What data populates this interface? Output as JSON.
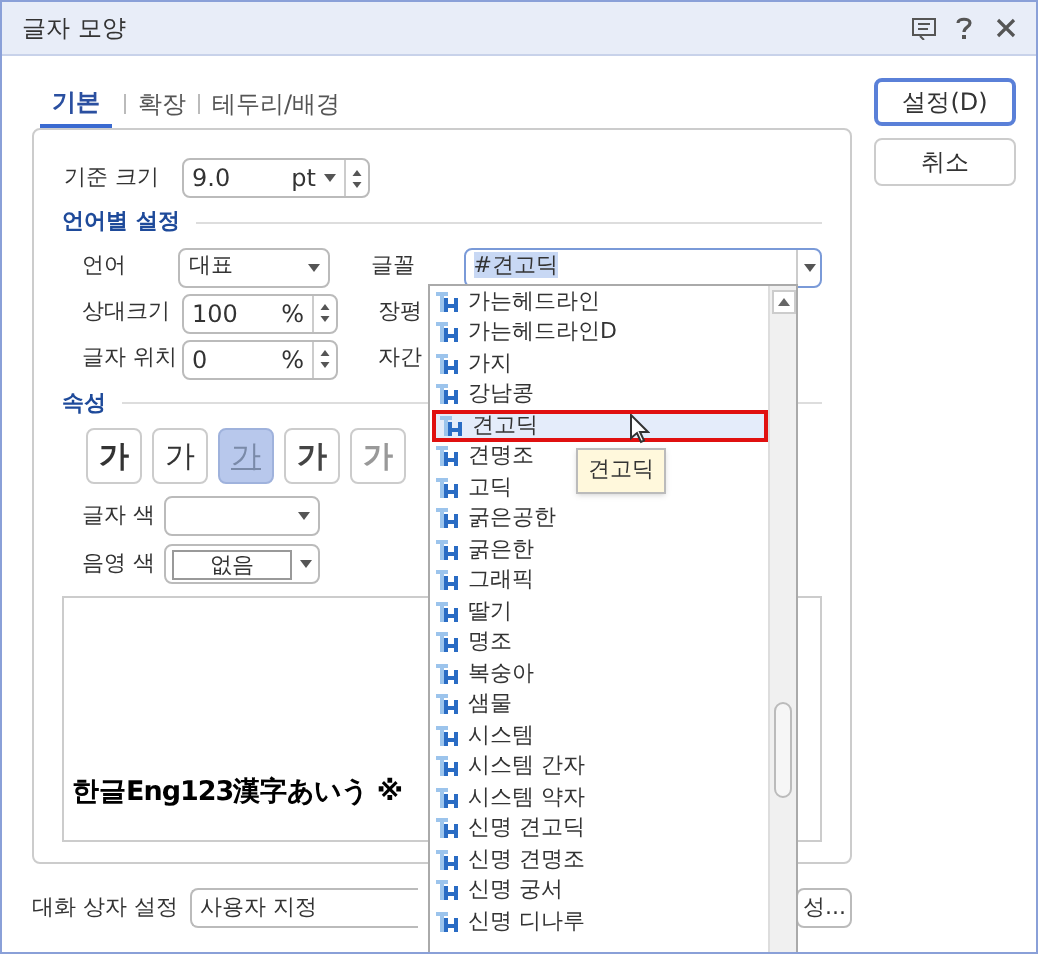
{
  "window": {
    "title": "글자 모양"
  },
  "tabs": [
    {
      "label": "기본",
      "selected": true
    },
    {
      "label": "확장",
      "selected": false
    },
    {
      "label": "테두리/배경",
      "selected": false
    }
  ],
  "base_size": {
    "label": "기준 크기",
    "value": "9.0",
    "unit": "pt"
  },
  "lang_section": {
    "title": "언어별 설정",
    "language": {
      "label": "언어",
      "value": "대표"
    },
    "relative_size": {
      "label": "상대크기",
      "value": "100",
      "unit": "%"
    },
    "position": {
      "label": "글자 위치",
      "value": "0",
      "unit": "%"
    },
    "font": {
      "label": "글꼴",
      "value": "#견고딕"
    },
    "width_label": "장평",
    "spacing_label": "자간"
  },
  "attributes": {
    "title": "속성",
    "buttons": [
      {
        "kind": "bold",
        "label": "가",
        "selected": false
      },
      {
        "kind": "italic",
        "label": "가",
        "selected": false
      },
      {
        "kind": "underline",
        "label": "가",
        "selected": true
      },
      {
        "kind": "outline",
        "label": "가",
        "selected": false
      },
      {
        "kind": "shadow",
        "label": "가",
        "selected": false
      }
    ]
  },
  "text_color": {
    "label": "글자 색"
  },
  "shade_color": {
    "label": "음영 색",
    "value": "없음"
  },
  "preview": {
    "text": "한글Eng123漢字あいう ※"
  },
  "dialog_setting": {
    "label": "대화 상자 설정",
    "value": "사용자 지정",
    "button": "성..."
  },
  "buttons": [
    {
      "label": "설정(D)",
      "kind": "primary"
    },
    {
      "label": "취소",
      "kind": "normal"
    }
  ],
  "font_list": {
    "tooltip": "견고딕",
    "items": [
      {
        "label": "가는헤드라인",
        "selected": false
      },
      {
        "label": "가는헤드라인D",
        "selected": false
      },
      {
        "label": "가지",
        "selected": false
      },
      {
        "label": "강남콩",
        "selected": false
      },
      {
        "label": "견고딕",
        "selected": true
      },
      {
        "label": "견명조",
        "selected": false
      },
      {
        "label": "고딕",
        "selected": false
      },
      {
        "label": "굵은공한",
        "selected": false
      },
      {
        "label": "굵은한",
        "selected": false
      },
      {
        "label": "그래픽",
        "selected": false
      },
      {
        "label": "딸기",
        "selected": false
      },
      {
        "label": "명조",
        "selected": false
      },
      {
        "label": "복숭아",
        "selected": false
      },
      {
        "label": "샘물",
        "selected": false
      },
      {
        "label": "시스템",
        "selected": false
      },
      {
        "label": "시스템 간자",
        "selected": false
      },
      {
        "label": "시스템 약자",
        "selected": false
      },
      {
        "label": "신명 견고딕",
        "selected": false
      },
      {
        "label": "신명 견명조",
        "selected": false
      },
      {
        "label": "신명 궁서",
        "selected": false
      },
      {
        "label": "신명 디나루",
        "selected": false
      }
    ]
  }
}
